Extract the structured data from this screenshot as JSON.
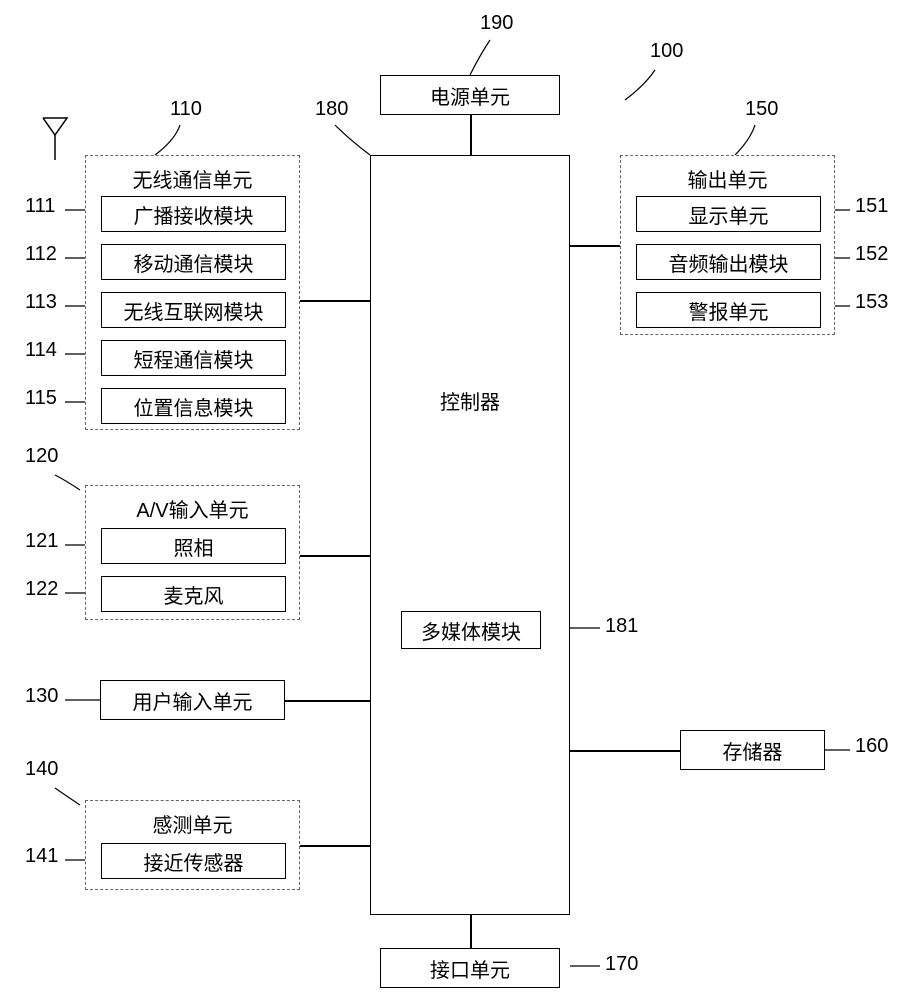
{
  "refs": {
    "device": "100",
    "wireless_unit": "110",
    "broadcast": "111",
    "mobile_comm": "112",
    "wifi": "113",
    "short_range": "114",
    "position": "115",
    "av_input": "120",
    "camera": "121",
    "mic": "122",
    "user_input": "130",
    "sensing": "140",
    "proximity": "141",
    "output": "150",
    "display": "151",
    "audio_out": "152",
    "alarm": "153",
    "memory": "160",
    "interface": "170",
    "controller": "180",
    "multimedia": "181",
    "power": "190"
  },
  "blocks": {
    "power": "电源单元",
    "wireless_unit": "无线通信单元",
    "broadcast": "广播接收模块",
    "mobile_comm": "移动通信模块",
    "wifi": "无线互联网模块",
    "short_range": "短程通信模块",
    "position": "位置信息模块",
    "av_input": "A/V输入单元",
    "camera": "照相",
    "mic": "麦克风",
    "user_input": "用户输入单元",
    "sensing": "感测单元",
    "proximity": "接近传感器",
    "output": "输出单元",
    "display": "显示单元",
    "audio_out": "音频输出模块",
    "alarm": "警报单元",
    "memory": "存储器",
    "interface": "接口单元",
    "controller": "控制器",
    "multimedia": "多媒体模块"
  }
}
